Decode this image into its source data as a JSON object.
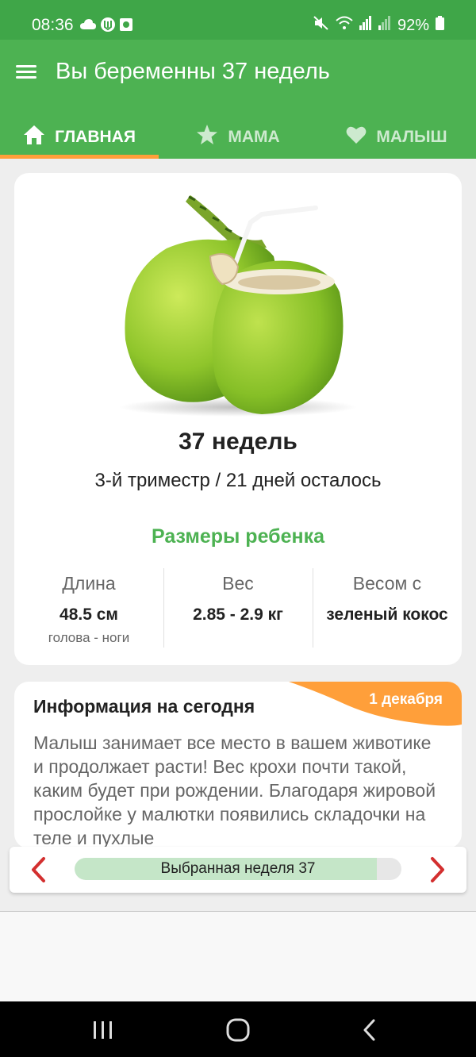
{
  "status_bar": {
    "time": "08:36",
    "battery_text": "92%",
    "battery_level_percent": 92,
    "left_icons": [
      "cloud-icon",
      "ukraine-trident-icon",
      "camera-app-icon"
    ],
    "right_icons": [
      "mute-icon",
      "wifi-icon",
      "signal-icon",
      "signal-weak-icon",
      "battery-icon"
    ]
  },
  "app_bar": {
    "title": "Вы беременны 37 недель",
    "menu_icon": "hamburger-icon",
    "background": "#4db252"
  },
  "tabs": [
    {
      "label": "ГЛАВНАЯ",
      "icon": "home-icon",
      "active": true
    },
    {
      "label": "МАМА",
      "icon": "star-icon",
      "active": false
    },
    {
      "label": "МАЛЫШ",
      "icon": "heart-icon",
      "active": false
    }
  ],
  "summary": {
    "image": "green-coconut",
    "week_title": "37 недель",
    "subtitle": "3-й триместр / 21 дней осталось",
    "sizes_title": "Размеры ребенка",
    "stats": [
      {
        "label": "Длина",
        "value": "48.5 см",
        "note": "голова - ноги"
      },
      {
        "label": "Вес",
        "value": "2.85 - 2.9 кг",
        "note": ""
      },
      {
        "label": "Весом с",
        "value": "зеленый кокос",
        "note": ""
      }
    ]
  },
  "info": {
    "title": "Информация на сегодня",
    "date": "1 декабря",
    "body": "Малыш занимает все место в вашем животике и продолжает расти! Вес крохи почти такой, каким будет при рождении. Благодаря жировой прослойке у малютки появились складочки на теле и пухлые"
  },
  "week_selector": {
    "label": "Выбранная неделя 37",
    "progress_fraction": 0.925,
    "prev_icon": "chevron-left-icon",
    "next_icon": "chevron-right-icon"
  },
  "colors": {
    "primary_green": "#4db252",
    "status_green": "#3fa648",
    "accent_orange": "#ff9f3a",
    "arrow_red": "#d32f2f"
  },
  "nav_bar": {
    "buttons": [
      "recents-icon",
      "home-circle-icon",
      "back-icon"
    ]
  }
}
